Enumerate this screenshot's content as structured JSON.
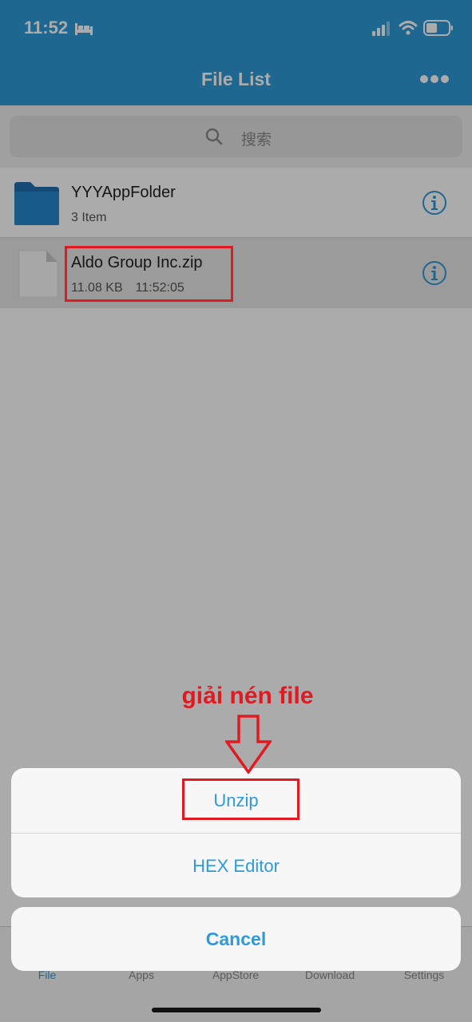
{
  "status_bar": {
    "time": "11:52"
  },
  "header": {
    "title": "File List"
  },
  "search": {
    "placeholder": "搜索"
  },
  "files": [
    {
      "name": "YYYAppFolder",
      "meta": "3 Item",
      "type": "folder"
    },
    {
      "name": "Aldo Group Inc.zip",
      "size": "11.08 KB",
      "time": "11:52:05",
      "type": "zip"
    }
  ],
  "tabs": [
    {
      "label": "File",
      "active": true
    },
    {
      "label": "Apps"
    },
    {
      "label": "AppStore"
    },
    {
      "label": "Download"
    },
    {
      "label": "Settings"
    }
  ],
  "action_sheet": {
    "options": [
      "Unzip",
      "HEX Editor"
    ],
    "cancel": "Cancel"
  },
  "annotation": {
    "text": "giải nén file"
  },
  "colors": {
    "accent": "#2d9ad9",
    "annotation": "#e11a22"
  }
}
